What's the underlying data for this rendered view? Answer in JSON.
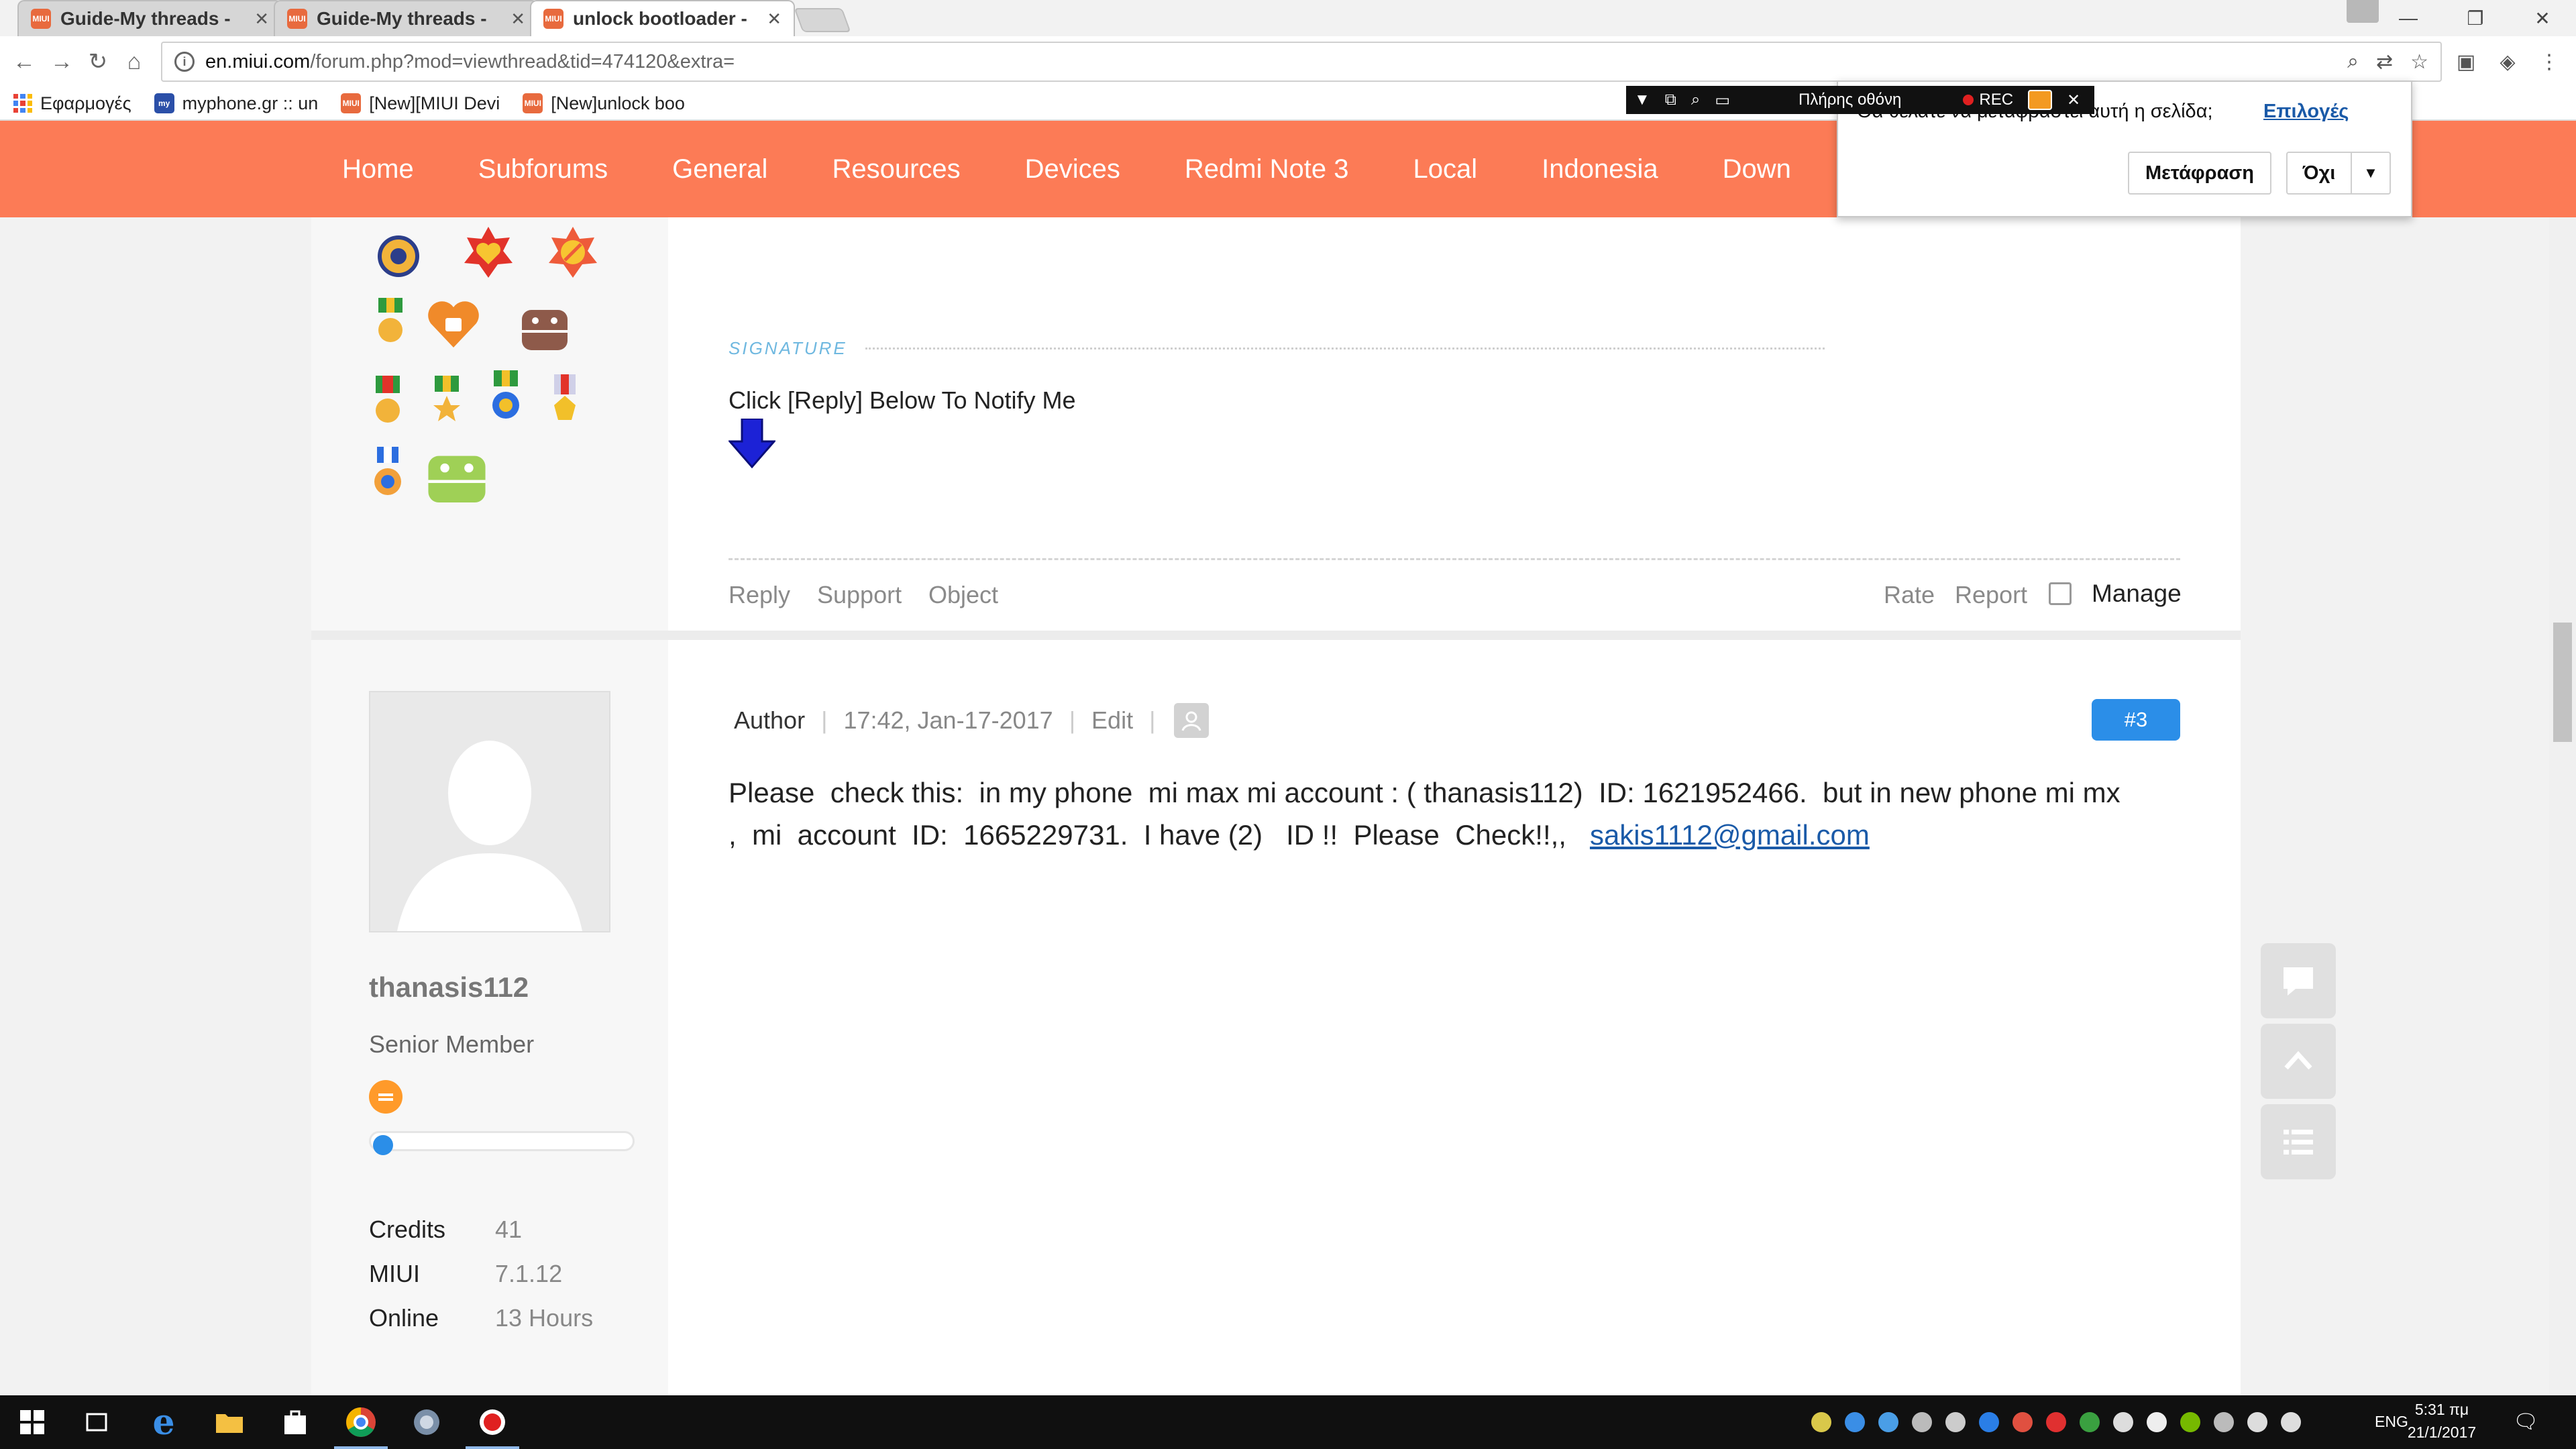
{
  "browser": {
    "tabs": [
      {
        "title": "Guide-My threads -",
        "active": false
      },
      {
        "title": "Guide-My threads -",
        "active": false
      },
      {
        "title": "unlock bootloader -",
        "active": true
      }
    ],
    "favicon_text": "MIUI",
    "url_host": "en.miui.com",
    "url_path": "/forum.php?mod=viewthread&tid=474120&extra=",
    "bookmarks": [
      {
        "label": "Εφαρμογές",
        "icon": "apps-grid-icon"
      },
      {
        "label": "myphone.gr :: un",
        "icon": "myphone-icon",
        "icon_text": "my"
      },
      {
        "label": "[New][MIUI Devi",
        "icon": "miui-icon"
      },
      {
        "label": "[New]unlock boo",
        "icon": "miui-icon"
      }
    ]
  },
  "site_nav": {
    "items": [
      "Home",
      "Subforums",
      "General",
      "Resources",
      "Devices",
      "Redmi Note 3",
      "Local",
      "Indonesia",
      "Down"
    ]
  },
  "post_prev": {
    "signature_label": "SIGNATURE",
    "signature_text": "Click [Reply] Below To Notify Me",
    "actions_left": [
      "Reply",
      "Support",
      "Object"
    ],
    "actions_right": [
      "Rate",
      "Report"
    ],
    "manage_label": "Manage"
  },
  "post": {
    "author_label": "Author",
    "timestamp": "17:42, Jan-17-2017",
    "edit_label": "Edit",
    "post_number": "#3",
    "body": "Please  check this:  in my phone  mi max mi account : ( thanasis112)  ID: 1621952466.  but in new phone mi mx\n,  mi  account  ID:  1665229731.  I have (2)   ID !!  Please  Check!!,,   ",
    "email": "sakis1112@gmail.com"
  },
  "user": {
    "username": "thanasis112",
    "title": "Senior Member",
    "level_progress": 0.05,
    "stats": [
      {
        "label": "Credits",
        "value": "41"
      },
      {
        "label": "MIUI",
        "value": "7.1.12"
      },
      {
        "label": "Online",
        "value": "13 Hours"
      }
    ]
  },
  "translate_bar": {
    "question": "Θα θέλατε να μεταφραστεί αυτή η σελίδα;",
    "options": "Επιλογές",
    "translate_button": "Μετάφραση",
    "no_button": "Όχι"
  },
  "recorder": {
    "fullscreen_label": "Πλήρης οθόνη",
    "rec_label": "REC"
  },
  "taskbar": {
    "lang": "ENG",
    "time": "5:31 πμ",
    "date": "21/1/2017"
  },
  "colors": {
    "nav_bg": "#fc7b56",
    "accent_blue": "#2b8ee8",
    "link": "#1a5aa8"
  }
}
